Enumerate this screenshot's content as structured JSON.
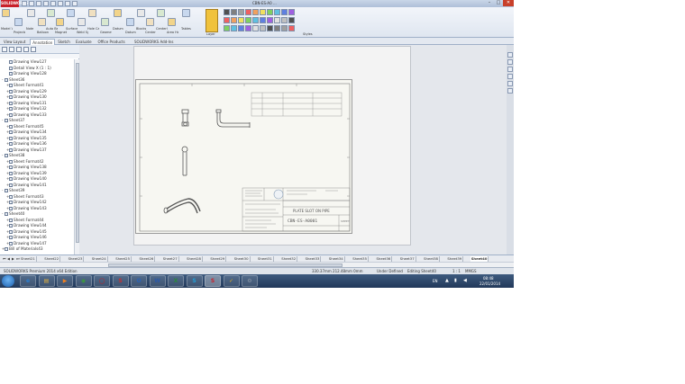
{
  "window": {
    "app_logo": "SOLIDWORKS",
    "title": "CBN-ES-A0 ...",
    "minimize": "–",
    "maximize": "□",
    "close": "✕"
  },
  "ribbon": {
    "groups": [
      {
        "label": "Model View"
      },
      {
        "label": "Projected View"
      },
      {
        "label": "Note"
      },
      {
        "label": "Balloon"
      },
      {
        "label": "Auto Balloon"
      },
      {
        "label": "Magnetic Line"
      },
      {
        "label": "Surface Finish"
      },
      {
        "label": "Weld Symbol"
      },
      {
        "label": "Hole Callout"
      },
      {
        "label": "Geometric Tolerance"
      },
      {
        "label": "Datum Feature"
      },
      {
        "label": "Datum Target"
      },
      {
        "label": "Blocks"
      },
      {
        "label": "Center Mark"
      },
      {
        "label": "Centerline"
      },
      {
        "label": "Area Hatch/Fill"
      },
      {
        "label": "Tables"
      }
    ],
    "layer_label": "Layer",
    "style_label": "Styles"
  },
  "command_tabs": [
    "View Layout",
    "Annotation",
    "Sketch",
    "Evaluate",
    "Office Products",
    "SOLIDWORKS Add-Ins"
  ],
  "active_tab": "Annotation",
  "tree": {
    "items": [
      {
        "label": "Drawing View127",
        "indent": 1,
        "exp": ""
      },
      {
        "label": "Detail View X (1 : 1)",
        "indent": 1,
        "exp": ""
      },
      {
        "label": "Drawing View128",
        "indent": 1,
        "exp": ""
      },
      {
        "label": "Sheet36",
        "indent": 0,
        "exp": "-"
      },
      {
        "label": "Sheet Format41",
        "indent": 1,
        "exp": "+"
      },
      {
        "label": "Drawing View129",
        "indent": 1,
        "exp": "+"
      },
      {
        "label": "Drawing View130",
        "indent": 1,
        "exp": "+"
      },
      {
        "label": "Drawing View131",
        "indent": 1,
        "exp": "+"
      },
      {
        "label": "Drawing View132",
        "indent": 1,
        "exp": "+"
      },
      {
        "label": "Drawing View133",
        "indent": 1,
        "exp": "+"
      },
      {
        "label": "Sheet37",
        "indent": 0,
        "exp": "-"
      },
      {
        "label": "Sheet Format45",
        "indent": 1,
        "exp": "+"
      },
      {
        "label": "Drawing View134",
        "indent": 1,
        "exp": "+"
      },
      {
        "label": "Drawing View135",
        "indent": 1,
        "exp": "+"
      },
      {
        "label": "Drawing View136",
        "indent": 1,
        "exp": "+"
      },
      {
        "label": "Drawing View137",
        "indent": 1,
        "exp": "+"
      },
      {
        "label": "Sheet38",
        "indent": 0,
        "exp": "-"
      },
      {
        "label": "Sheet Format42",
        "indent": 1,
        "exp": "+"
      },
      {
        "label": "Drawing View138",
        "indent": 1,
        "exp": "+"
      },
      {
        "label": "Drawing View139",
        "indent": 1,
        "exp": "+"
      },
      {
        "label": "Drawing View140",
        "indent": 1,
        "exp": "+"
      },
      {
        "label": "Drawing View141",
        "indent": 1,
        "exp": "+"
      },
      {
        "label": "Sheet39",
        "indent": 0,
        "exp": "-"
      },
      {
        "label": "Sheet Format43",
        "indent": 1,
        "exp": "+"
      },
      {
        "label": "Drawing View142",
        "indent": 1,
        "exp": "+"
      },
      {
        "label": "Drawing View143",
        "indent": 1,
        "exp": "+"
      },
      {
        "label": "Sheet40",
        "indent": 0,
        "exp": "-"
      },
      {
        "label": "Sheet Format44",
        "indent": 1,
        "exp": "+"
      },
      {
        "label": "Drawing View144",
        "indent": 1,
        "exp": "+"
      },
      {
        "label": "Drawing View145",
        "indent": 1,
        "exp": "+"
      },
      {
        "label": "Drawing View146",
        "indent": 1,
        "exp": "+"
      },
      {
        "label": "Drawing View147",
        "indent": 1,
        "exp": "+"
      },
      {
        "label": "Bill of Materials43",
        "indent": 0,
        "exp": "+"
      }
    ]
  },
  "title_block": {
    "part_title": "PLATE SLOT ON PIPE",
    "drawing_number": "CBN-ES-A0001",
    "sheet_label": "SHEET"
  },
  "sheet_tabs": [
    "Sheet21",
    "Sheet22",
    "Sheet23",
    "Sheet24",
    "Sheet25",
    "Sheet26",
    "Sheet27",
    "Sheet28",
    "Sheet29",
    "Sheet30",
    "Sheet31",
    "Sheet32",
    "Sheet33",
    "Sheet34",
    "Sheet35",
    "Sheet36",
    "Sheet37",
    "Sheet38",
    "Sheet39",
    "Sheet40"
  ],
  "active_sheet": "Sheet40",
  "status": {
    "left": "SOLIDWORKS Premium 2014 x64 Edition",
    "coords": "330.37mm    212.48mm    0mm",
    "state": "Under Defined",
    "editing": "Editing Sheet40",
    "scale": "1 : 1",
    "units": "MMGS"
  },
  "taskbar": {
    "apps": [
      {
        "glyph": "e",
        "color": "#2a7fd4",
        "name": "ie"
      },
      {
        "glyph": "▤",
        "color": "#e0b040",
        "name": "explorer"
      },
      {
        "glyph": "▶",
        "color": "#f08020",
        "name": "media"
      },
      {
        "glyph": "◉",
        "color": "#3c9a3c",
        "name": "chrome"
      },
      {
        "glyph": "◯",
        "color": "#c82020",
        "name": "opera"
      },
      {
        "glyph": "S",
        "color": "#c83030",
        "name": "solidworks-launcher"
      },
      {
        "glyph": "O",
        "color": "#2a62b8",
        "name": "outlook"
      },
      {
        "glyph": "W",
        "color": "#2a58a8",
        "name": "word"
      },
      {
        "glyph": "X",
        "color": "#2a8a3a",
        "name": "excel"
      },
      {
        "glyph": "S",
        "color": "#20a0d8",
        "name": "skype"
      },
      {
        "glyph": "S",
        "color": "#c8202a",
        "name": "solidworks"
      },
      {
        "glyph": "✓",
        "color": "#e0b020",
        "name": "checker"
      },
      {
        "glyph": "⚙",
        "color": "#8a98a8",
        "name": "settings"
      }
    ],
    "lang": "EN",
    "time": "08:48",
    "date": "22/01/2014"
  }
}
